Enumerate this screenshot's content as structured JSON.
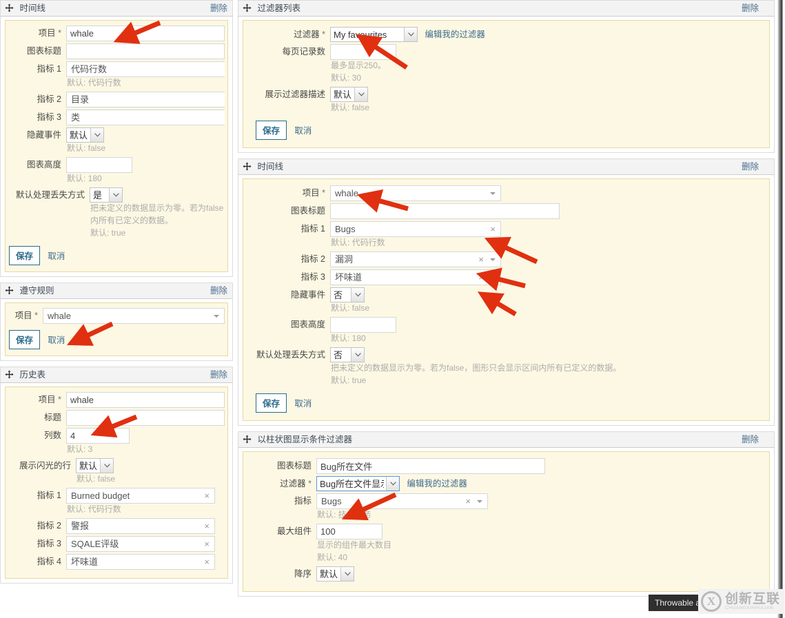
{
  "common": {
    "delete_label": "删除",
    "save_label": "保存",
    "cancel_label": "取消",
    "required_mark": "*",
    "edit_my_filters_label": "编辑我的过滤器",
    "move_icon": "move-cross-icon",
    "clear_icon": "×",
    "accent_link_color": "#3f6b8e",
    "panel_bg_color": "#fcf8e3",
    "panel_border_color": "#e8d8a0",
    "arrow_color": "#e03010"
  },
  "left_column": {
    "widgets": [
      {
        "title": "时间线",
        "delete": "删除",
        "fields": {
          "project_label": "项目",
          "project_value": "whale",
          "chart_title_label": "图表标题",
          "chart_title_value": "",
          "metric1_label": "指标 1",
          "metric1_value": "代码行数",
          "metric1_hint": "默认: 代码行数",
          "metric2_label": "指标 2",
          "metric2_value": "目录",
          "metric3_label": "指标 3",
          "metric3_value": "类",
          "hide_events_label": "隐藏事件",
          "hide_events_value": "默认",
          "hide_events_hint": "默认: false",
          "chart_height_label": "图表高度",
          "chart_height_value": "",
          "chart_height_hint": "默认: 180",
          "missing_label": "默认处理丢失方式",
          "missing_value": "是",
          "missing_hint_line1": "把未定义的数据显示为零。若为false",
          "missing_hint_line2": "内所有已定义的数据。",
          "missing_hint_line3": "默认: true"
        }
      },
      {
        "title": "遵守规则",
        "delete": "删除",
        "fields": {
          "project_label": "项目",
          "project_value": "whale"
        }
      },
      {
        "title": "历史表",
        "delete": "删除",
        "fields": {
          "project_label": "项目",
          "project_value": "whale",
          "title_label": "标题",
          "title_value": "",
          "columns_label": "列数",
          "columns_value": "4",
          "columns_hint": "默认: 3",
          "sparkline_label": "展示闪光的行",
          "sparkline_value": "默认",
          "sparkline_hint": "默认: false",
          "metric1_label": "指标 1",
          "metric1_value": "Burned budget",
          "metric1_hint": "默认: 代码行数",
          "metric2_label": "指标 2",
          "metric2_value": "警报",
          "metric3_label": "指标 3",
          "metric3_value": "SQALE评级",
          "metric4_label": "指标 4",
          "metric4_value": "坏味道"
        }
      }
    ]
  },
  "right_column": {
    "widgets": [
      {
        "title": "过滤器列表",
        "delete": "删除",
        "fields": {
          "filter_label": "过滤器",
          "filter_value": "My favourites",
          "filter_options": [
            "My favourites"
          ],
          "edit_link": "编辑我的过滤器",
          "page_size_label": "每页记录数",
          "page_size_value": "",
          "page_size_hint1": "最多显示250。",
          "page_size_hint2": "默认: 30",
          "show_desc_label": "展示过滤器描述",
          "show_desc_value": "默认",
          "show_desc_hint": "默认: false"
        }
      },
      {
        "title": "时间线",
        "delete": "删除",
        "fields": {
          "project_label": "项目",
          "project_value": "whale",
          "chart_title_label": "图表标题",
          "chart_title_value": "",
          "metric1_label": "指标 1",
          "metric1_value": "Bugs",
          "metric1_hint": "默认: 代码行数",
          "metric2_label": "指标 2",
          "metric2_value": "漏洞",
          "metric3_label": "指标 3",
          "metric3_value": "坏味道",
          "hide_events_label": "隐藏事件",
          "hide_events_value": "否",
          "hide_events_hint": "默认: false",
          "chart_height_label": "图表高度",
          "chart_height_value": "",
          "chart_height_hint": "默认: 180",
          "missing_label": "默认处理丢失方式",
          "missing_value": "否",
          "missing_hint1": "把未定义的数据显示为零。若为false，图形只会显示区间内所有已定义的数据。",
          "missing_hint2": "默认: true"
        }
      },
      {
        "title": "以柱状图显示条件过滤器",
        "delete": "删除",
        "fields": {
          "chart_title_label": "图表标题",
          "chart_title_value": "Bug所在文件",
          "filter_label": "过滤器",
          "filter_value": "Bug所在文件显示",
          "filter_options": [
            "Bug所在文件显示"
          ],
          "edit_link": "编辑我的过滤器",
          "metric_label": "指标",
          "metric_value": "Bugs",
          "metric_hint": "默认: 技术债务",
          "max_components_label": "最大组件",
          "max_components_value": "100",
          "max_components_hint1": "显示的组件最大数目",
          "max_components_hint2": "默认: 40",
          "desc_label": "降序",
          "desc_value": "默认"
        }
      }
    ]
  },
  "overlays": {
    "tooltip_text": "Throwable and E",
    "watermark_logo": "X",
    "watermark_main": "创新互联",
    "watermark_sub": "CHUANGXINHULIAN"
  }
}
